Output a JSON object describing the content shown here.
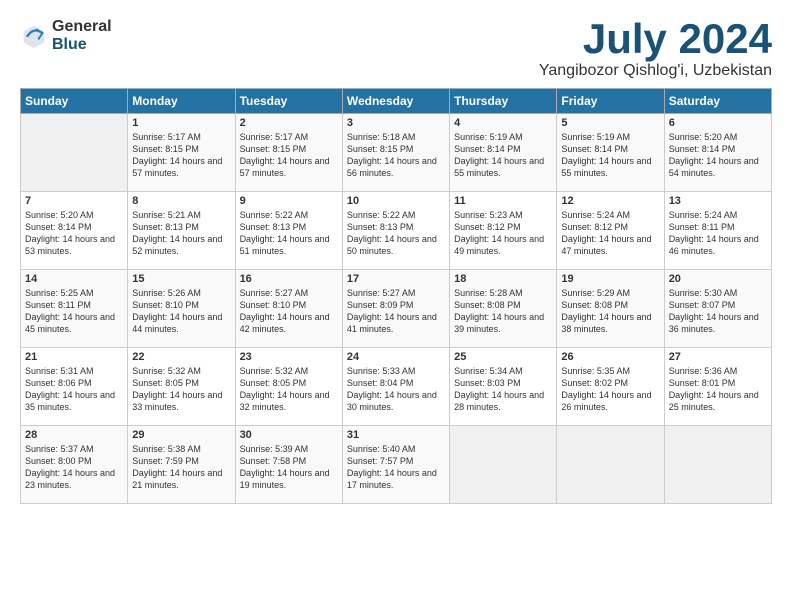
{
  "header": {
    "logo_general": "General",
    "logo_blue": "Blue",
    "month_title": "July 2024",
    "location": "Yangibozor Qishlog'i, Uzbekistan"
  },
  "days_of_week": [
    "Sunday",
    "Monday",
    "Tuesday",
    "Wednesday",
    "Thursday",
    "Friday",
    "Saturday"
  ],
  "weeks": [
    [
      {
        "day": "",
        "sunrise": "",
        "sunset": "",
        "daylight": ""
      },
      {
        "day": "1",
        "sunrise": "Sunrise: 5:17 AM",
        "sunset": "Sunset: 8:15 PM",
        "daylight": "Daylight: 14 hours and 57 minutes."
      },
      {
        "day": "2",
        "sunrise": "Sunrise: 5:17 AM",
        "sunset": "Sunset: 8:15 PM",
        "daylight": "Daylight: 14 hours and 57 minutes."
      },
      {
        "day": "3",
        "sunrise": "Sunrise: 5:18 AM",
        "sunset": "Sunset: 8:15 PM",
        "daylight": "Daylight: 14 hours and 56 minutes."
      },
      {
        "day": "4",
        "sunrise": "Sunrise: 5:19 AM",
        "sunset": "Sunset: 8:14 PM",
        "daylight": "Daylight: 14 hours and 55 minutes."
      },
      {
        "day": "5",
        "sunrise": "Sunrise: 5:19 AM",
        "sunset": "Sunset: 8:14 PM",
        "daylight": "Daylight: 14 hours and 55 minutes."
      },
      {
        "day": "6",
        "sunrise": "Sunrise: 5:20 AM",
        "sunset": "Sunset: 8:14 PM",
        "daylight": "Daylight: 14 hours and 54 minutes."
      }
    ],
    [
      {
        "day": "7",
        "sunrise": "Sunrise: 5:20 AM",
        "sunset": "Sunset: 8:14 PM",
        "daylight": "Daylight: 14 hours and 53 minutes."
      },
      {
        "day": "8",
        "sunrise": "Sunrise: 5:21 AM",
        "sunset": "Sunset: 8:13 PM",
        "daylight": "Daylight: 14 hours and 52 minutes."
      },
      {
        "day": "9",
        "sunrise": "Sunrise: 5:22 AM",
        "sunset": "Sunset: 8:13 PM",
        "daylight": "Daylight: 14 hours and 51 minutes."
      },
      {
        "day": "10",
        "sunrise": "Sunrise: 5:22 AM",
        "sunset": "Sunset: 8:13 PM",
        "daylight": "Daylight: 14 hours and 50 minutes."
      },
      {
        "day": "11",
        "sunrise": "Sunrise: 5:23 AM",
        "sunset": "Sunset: 8:12 PM",
        "daylight": "Daylight: 14 hours and 49 minutes."
      },
      {
        "day": "12",
        "sunrise": "Sunrise: 5:24 AM",
        "sunset": "Sunset: 8:12 PM",
        "daylight": "Daylight: 14 hours and 47 minutes."
      },
      {
        "day": "13",
        "sunrise": "Sunrise: 5:24 AM",
        "sunset": "Sunset: 8:11 PM",
        "daylight": "Daylight: 14 hours and 46 minutes."
      }
    ],
    [
      {
        "day": "14",
        "sunrise": "Sunrise: 5:25 AM",
        "sunset": "Sunset: 8:11 PM",
        "daylight": "Daylight: 14 hours and 45 minutes."
      },
      {
        "day": "15",
        "sunrise": "Sunrise: 5:26 AM",
        "sunset": "Sunset: 8:10 PM",
        "daylight": "Daylight: 14 hours and 44 minutes."
      },
      {
        "day": "16",
        "sunrise": "Sunrise: 5:27 AM",
        "sunset": "Sunset: 8:10 PM",
        "daylight": "Daylight: 14 hours and 42 minutes."
      },
      {
        "day": "17",
        "sunrise": "Sunrise: 5:27 AM",
        "sunset": "Sunset: 8:09 PM",
        "daylight": "Daylight: 14 hours and 41 minutes."
      },
      {
        "day": "18",
        "sunrise": "Sunrise: 5:28 AM",
        "sunset": "Sunset: 8:08 PM",
        "daylight": "Daylight: 14 hours and 39 minutes."
      },
      {
        "day": "19",
        "sunrise": "Sunrise: 5:29 AM",
        "sunset": "Sunset: 8:08 PM",
        "daylight": "Daylight: 14 hours and 38 minutes."
      },
      {
        "day": "20",
        "sunrise": "Sunrise: 5:30 AM",
        "sunset": "Sunset: 8:07 PM",
        "daylight": "Daylight: 14 hours and 36 minutes."
      }
    ],
    [
      {
        "day": "21",
        "sunrise": "Sunrise: 5:31 AM",
        "sunset": "Sunset: 8:06 PM",
        "daylight": "Daylight: 14 hours and 35 minutes."
      },
      {
        "day": "22",
        "sunrise": "Sunrise: 5:32 AM",
        "sunset": "Sunset: 8:05 PM",
        "daylight": "Daylight: 14 hours and 33 minutes."
      },
      {
        "day": "23",
        "sunrise": "Sunrise: 5:32 AM",
        "sunset": "Sunset: 8:05 PM",
        "daylight": "Daylight: 14 hours and 32 minutes."
      },
      {
        "day": "24",
        "sunrise": "Sunrise: 5:33 AM",
        "sunset": "Sunset: 8:04 PM",
        "daylight": "Daylight: 14 hours and 30 minutes."
      },
      {
        "day": "25",
        "sunrise": "Sunrise: 5:34 AM",
        "sunset": "Sunset: 8:03 PM",
        "daylight": "Daylight: 14 hours and 28 minutes."
      },
      {
        "day": "26",
        "sunrise": "Sunrise: 5:35 AM",
        "sunset": "Sunset: 8:02 PM",
        "daylight": "Daylight: 14 hours and 26 minutes."
      },
      {
        "day": "27",
        "sunrise": "Sunrise: 5:36 AM",
        "sunset": "Sunset: 8:01 PM",
        "daylight": "Daylight: 14 hours and 25 minutes."
      }
    ],
    [
      {
        "day": "28",
        "sunrise": "Sunrise: 5:37 AM",
        "sunset": "Sunset: 8:00 PM",
        "daylight": "Daylight: 14 hours and 23 minutes."
      },
      {
        "day": "29",
        "sunrise": "Sunrise: 5:38 AM",
        "sunset": "Sunset: 7:59 PM",
        "daylight": "Daylight: 14 hours and 21 minutes."
      },
      {
        "day": "30",
        "sunrise": "Sunrise: 5:39 AM",
        "sunset": "Sunset: 7:58 PM",
        "daylight": "Daylight: 14 hours and 19 minutes."
      },
      {
        "day": "31",
        "sunrise": "Sunrise: 5:40 AM",
        "sunset": "Sunset: 7:57 PM",
        "daylight": "Daylight: 14 hours and 17 minutes."
      },
      {
        "day": "",
        "sunrise": "",
        "sunset": "",
        "daylight": ""
      },
      {
        "day": "",
        "sunrise": "",
        "sunset": "",
        "daylight": ""
      },
      {
        "day": "",
        "sunrise": "",
        "sunset": "",
        "daylight": ""
      }
    ]
  ]
}
